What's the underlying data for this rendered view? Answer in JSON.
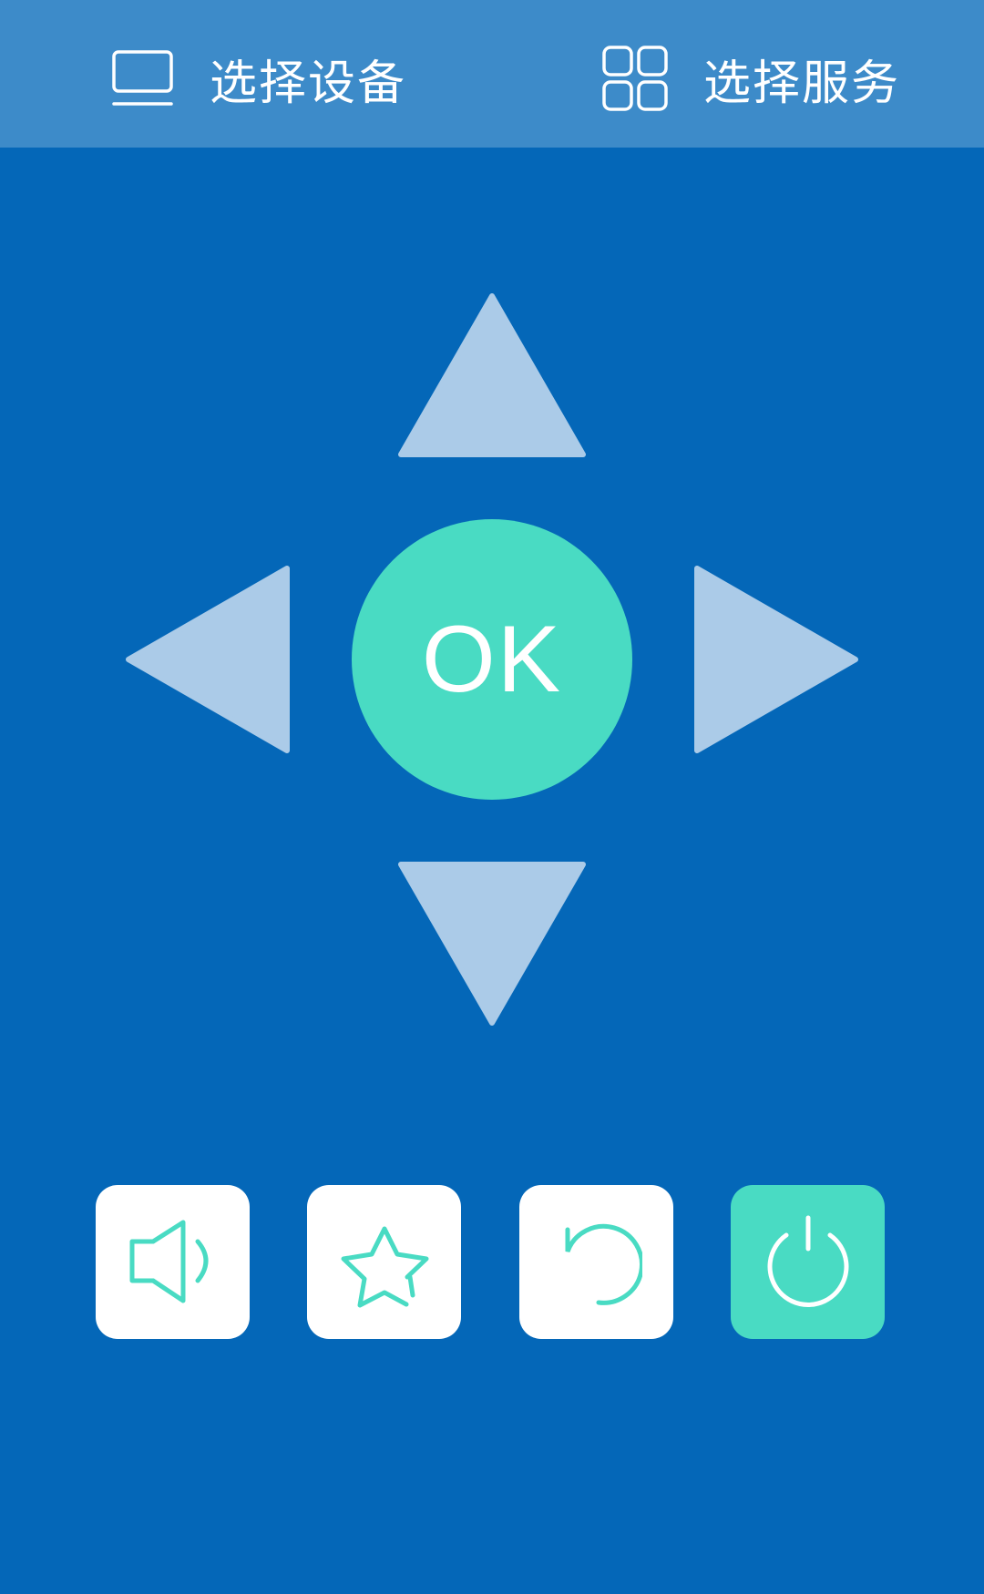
{
  "header": {
    "select_device_label": "选择设备",
    "select_device_icon": "monitor-icon",
    "select_service_label": "选择服务",
    "select_service_icon": "grid-icon"
  },
  "dpad": {
    "up_icon": "arrow-up-icon",
    "down_icon": "arrow-down-icon",
    "left_icon": "arrow-left-icon",
    "right_icon": "arrow-right-icon",
    "ok_label": "OK"
  },
  "function_buttons": [
    {
      "icon": "volume-icon"
    },
    {
      "icon": "star-icon"
    },
    {
      "icon": "back-icon"
    },
    {
      "icon": "power-icon"
    }
  ],
  "colors": {
    "background": "#0467b8",
    "header_background": "#3d8bc9",
    "dpad_arrow": "#abcbe8",
    "accent": "#49dbc3",
    "button_background": "#ffffff"
  }
}
